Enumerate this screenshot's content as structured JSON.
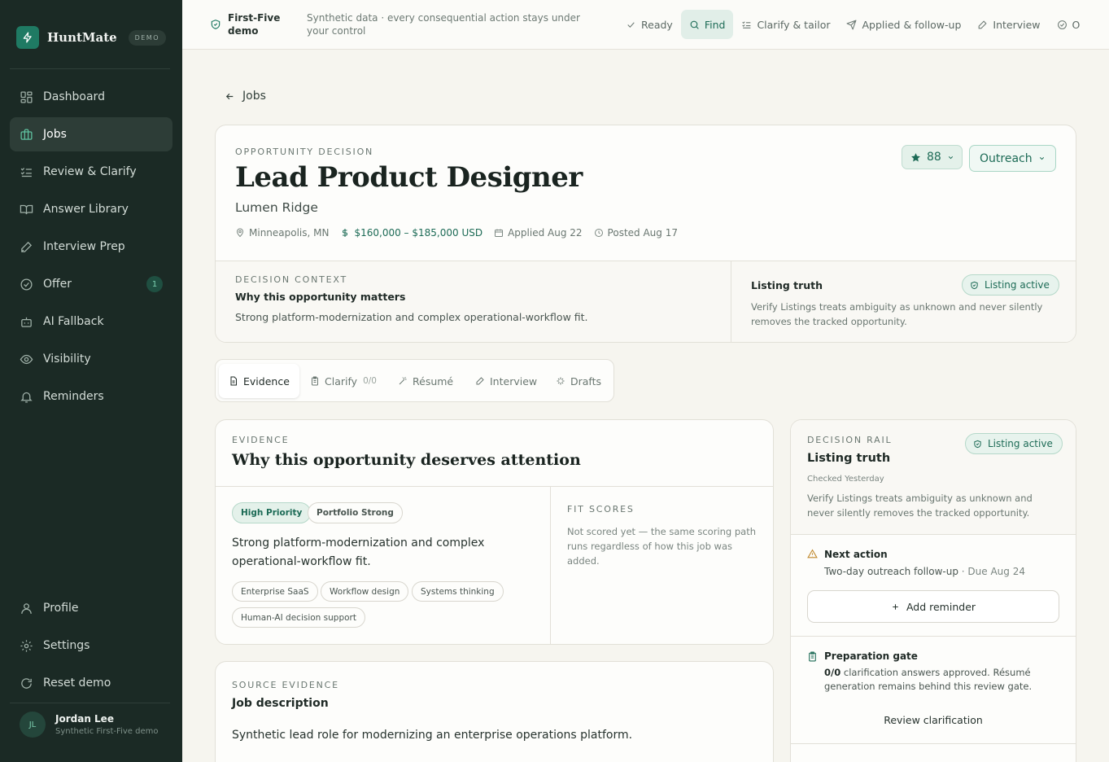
{
  "brand": {
    "name": "HuntMate",
    "badge": "DEMO"
  },
  "sidebar": {
    "items": [
      {
        "label": "Dashboard",
        "icon": "layout-grid-icon"
      },
      {
        "label": "Jobs",
        "icon": "briefcase-icon",
        "active": true
      },
      {
        "label": "Review & Clarify",
        "icon": "list-check-icon"
      },
      {
        "label": "Answer Library",
        "icon": "book-open-icon"
      },
      {
        "label": "Interview Prep",
        "icon": "pen-icon"
      },
      {
        "label": "Offer",
        "icon": "check-circle-icon",
        "count": "1"
      },
      {
        "label": "AI Fallback",
        "icon": "bot-icon"
      },
      {
        "label": "Visibility",
        "icon": "eye-icon"
      },
      {
        "label": "Reminders",
        "icon": "bell-icon"
      }
    ],
    "bottom_items": [
      {
        "label": "Profile",
        "icon": "user-icon"
      },
      {
        "label": "Settings",
        "icon": "gear-icon"
      },
      {
        "label": "Reset demo",
        "icon": "refresh-icon"
      }
    ],
    "user": {
      "initials": "JL",
      "name": "Jordan Lee",
      "subtitle": "Synthetic First-Five demo"
    }
  },
  "topbar": {
    "demo_label": "First-Five demo",
    "note": "Synthetic data · every consequential action stays under your control",
    "steps": [
      {
        "label": "Ready",
        "icon": "check-icon"
      },
      {
        "label": "Find",
        "icon": "search-icon",
        "active": true
      },
      {
        "label": "Clarify & tailor",
        "icon": "list-check-icon"
      },
      {
        "label": "Applied & follow-up",
        "icon": "send-icon"
      },
      {
        "label": "Interview",
        "icon": "pen-icon"
      },
      {
        "label": "O",
        "icon": "check-circle-icon"
      }
    ]
  },
  "back": {
    "label": "Jobs"
  },
  "job": {
    "eyebrow": "OPPORTUNITY DECISION",
    "title": "Lead Product Designer",
    "company": "Lumen Ridge",
    "location": "Minneapolis, MN",
    "salary": "$160,000 – $185,000 USD",
    "applied": "Applied Aug 22",
    "posted": "Posted Aug 17",
    "score": "88",
    "stage": "Outreach"
  },
  "decision_context": {
    "eyebrow": "DECISION CONTEXT",
    "title": "Why this opportunity matters",
    "body": "Strong platform-modernization and complex operational-workflow fit."
  },
  "listing_truth": {
    "title": "Listing truth",
    "badge": "Listing active",
    "body": "Verify Listings treats ambiguity as unknown and never silently removes the tracked opportunity."
  },
  "tabs": [
    {
      "label": "Evidence",
      "icon": "file-icon",
      "active": true
    },
    {
      "label": "Clarify",
      "icon": "clipboard-icon",
      "count": "0/0"
    },
    {
      "label": "Résumé",
      "icon": "magic-wand-icon"
    },
    {
      "label": "Interview",
      "icon": "pen-icon"
    },
    {
      "label": "Drafts",
      "icon": "sparkle-icon"
    }
  ],
  "evidence": {
    "eyebrow": "EVIDENCE",
    "title": "Why this opportunity deserves attention",
    "badges": [
      "High Priority",
      "Portfolio Strong"
    ],
    "summary": "Strong platform-modernization and complex operational-workflow fit.",
    "tags": [
      "Enterprise SaaS",
      "Workflow design",
      "Systems thinking",
      "Human-AI decision support"
    ],
    "fit_label": "FIT SCORES",
    "fit_body": "Not scored yet — the same scoring path runs regardless of how this job was added."
  },
  "source": {
    "eyebrow": "SOURCE EVIDENCE",
    "title": "Job description",
    "body": "Synthetic lead role for modernizing an enterprise operations platform."
  },
  "rail": {
    "eyebrow": "DECISION RAIL",
    "title": "Listing truth",
    "badge": "Listing active",
    "checked": "Checked Yesterday",
    "body": "Verify Listings treats ambiguity as unknown and never silently removes the tracked opportunity.",
    "next_action": {
      "title": "Next action",
      "body": "Two-day outreach follow-up",
      "due": " · Due Aug 24",
      "button": "Add reminder"
    },
    "gate": {
      "title": "Preparation gate",
      "count": "0/0",
      "body": " clarification answers approved. Résumé generation remains behind this review gate.",
      "button": "Review clarification"
    }
  },
  "colors": {
    "sidebar_bg": "#1b2a25",
    "accent": "#1d6b56",
    "page_bg": "#f6f5ef",
    "warning": "#c0872a"
  }
}
